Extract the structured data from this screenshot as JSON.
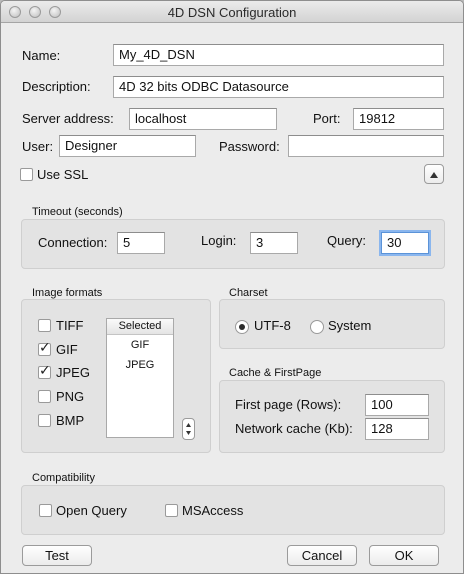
{
  "window": {
    "title": "4D DSN Configuration"
  },
  "fields": {
    "name": {
      "label": "Name:",
      "value": "My_4D_DSN"
    },
    "description": {
      "label": "Description:",
      "value": "4D 32 bits ODBC Datasource"
    },
    "server_address": {
      "label": "Server address:",
      "value": "localhost"
    },
    "port": {
      "label": "Port:",
      "value": "19812"
    },
    "user": {
      "label": "User:",
      "value": "Designer"
    },
    "password": {
      "label": "Password:",
      "value": ""
    }
  },
  "use_ssl": {
    "label": "Use SSL",
    "checked": false
  },
  "timeout": {
    "title": "Timeout (seconds)",
    "connection": {
      "label": "Connection:",
      "value": "5"
    },
    "login": {
      "label": "Login:",
      "value": "3"
    },
    "query": {
      "label": "Query:",
      "value": "30"
    }
  },
  "image_formats": {
    "title": "Image formats",
    "options": [
      {
        "label": "TIFF",
        "checked": false
      },
      {
        "label": "GIF",
        "checked": true
      },
      {
        "label": "JPEG",
        "checked": true
      },
      {
        "label": "PNG",
        "checked": false
      },
      {
        "label": "BMP",
        "checked": false
      }
    ],
    "selected_header": "Selected",
    "selected": [
      "GIF",
      "JPEG"
    ]
  },
  "charset": {
    "title": "Charset",
    "options": [
      {
        "label": "UTF-8",
        "selected": true
      },
      {
        "label": "System",
        "selected": false
      }
    ]
  },
  "cache": {
    "title": "Cache & FirstPage",
    "first_page": {
      "label": "First page (Rows):",
      "value": "100"
    },
    "network_cache": {
      "label": "Network cache (Kb):",
      "value": "128"
    }
  },
  "compatibility": {
    "title": "Compatibility",
    "options": [
      {
        "label": "Open Query",
        "checked": false
      },
      {
        "label": "MSAccess",
        "checked": false
      }
    ]
  },
  "buttons": {
    "test": "Test",
    "cancel": "Cancel",
    "ok": "OK"
  }
}
